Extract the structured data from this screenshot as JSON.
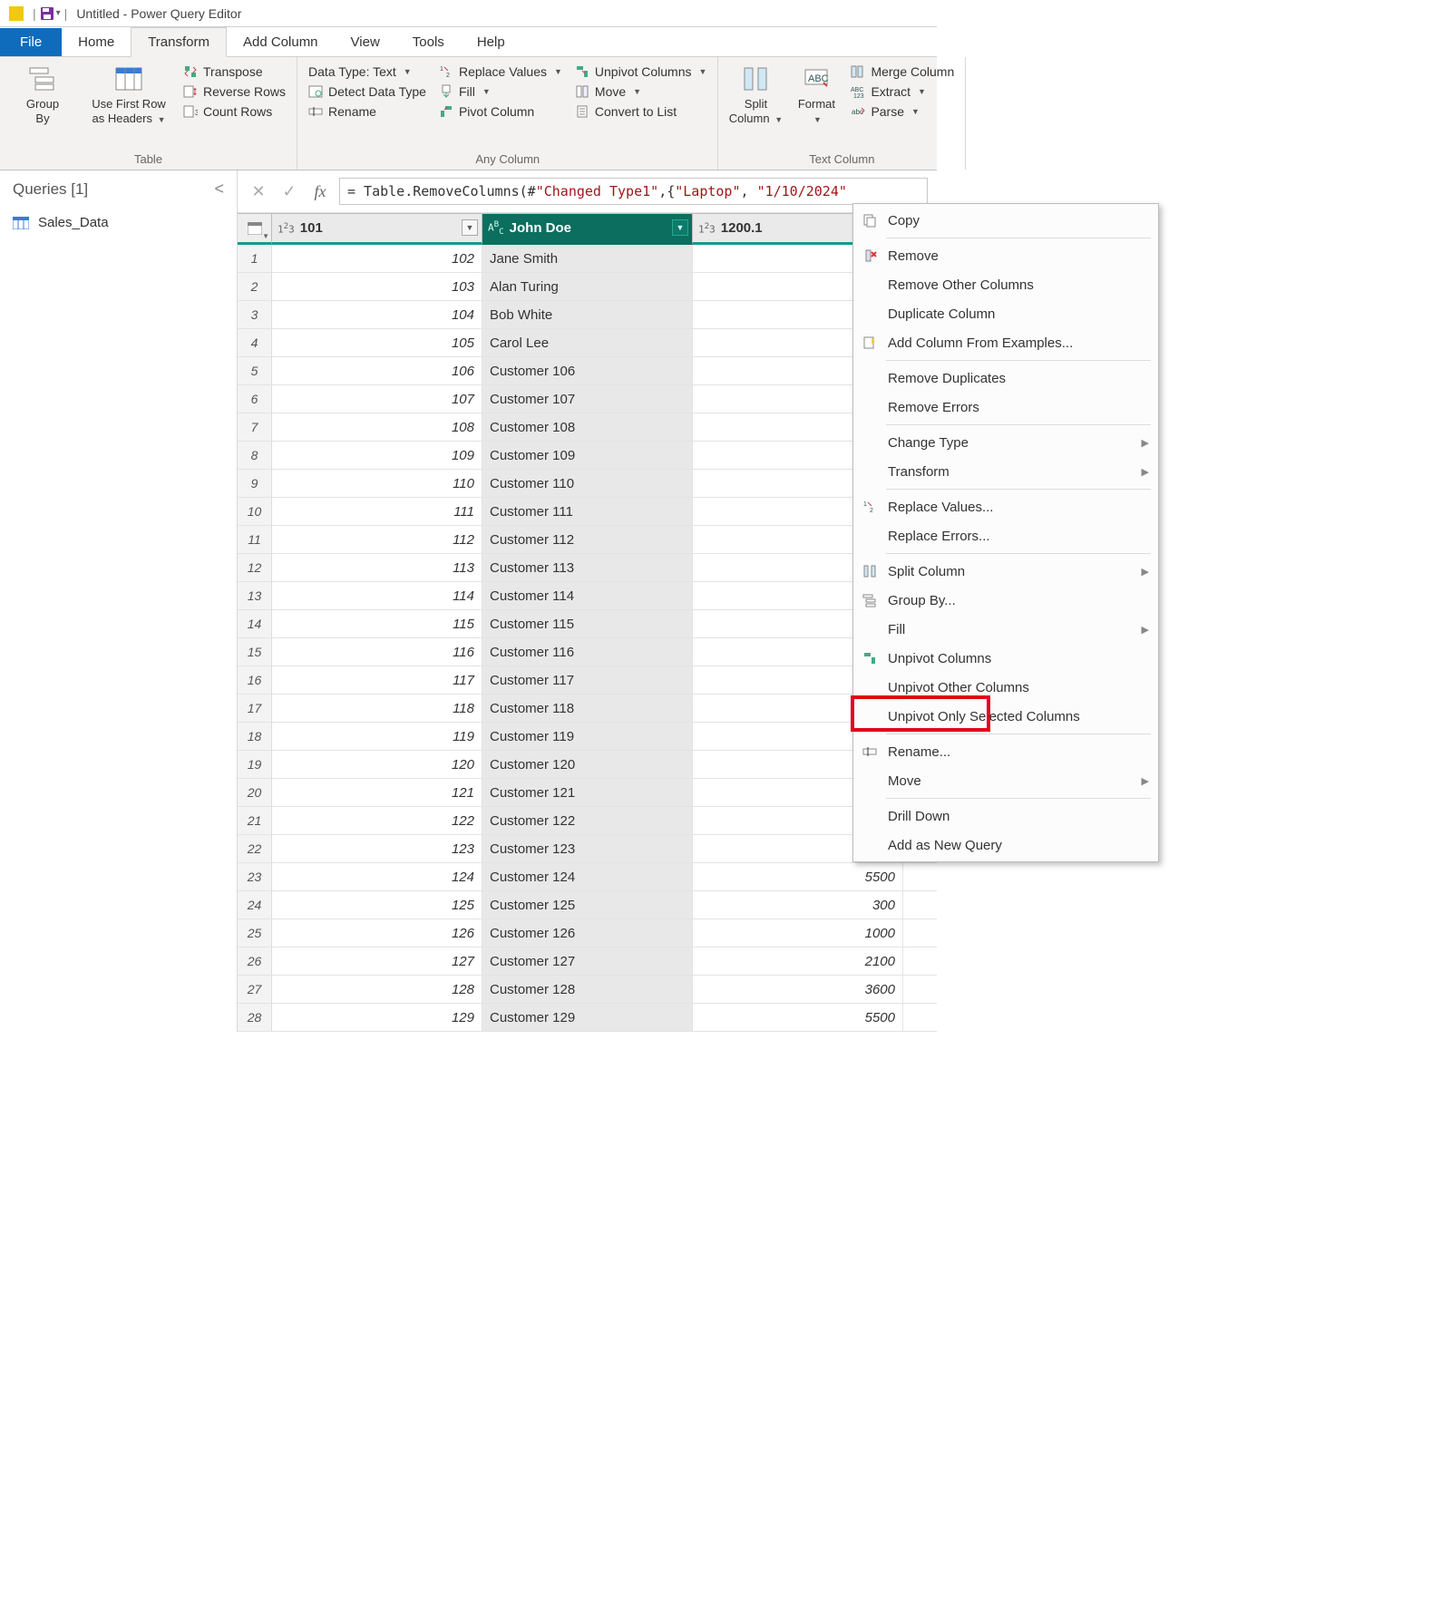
{
  "titlebar": {
    "title": "Untitled - Power Query Editor"
  },
  "tabs": {
    "file": "File",
    "home": "Home",
    "transform": "Transform",
    "addcol": "Add Column",
    "view": "View",
    "tools": "Tools",
    "help": "Help"
  },
  "ribbon": {
    "table": {
      "group_by": "Group\nBy",
      "use_first_row": "Use First Row\nas Headers",
      "transpose": "Transpose",
      "reverse_rows": "Reverse Rows",
      "count_rows": "Count Rows",
      "label": "Table"
    },
    "anycol": {
      "data_type": "Data Type: Text",
      "detect": "Detect Data Type",
      "rename": "Rename",
      "replace": "Replace Values",
      "fill": "Fill",
      "pivot": "Pivot Column",
      "unpivot": "Unpivot Columns",
      "move": "Move",
      "convert": "Convert to List",
      "label": "Any Column"
    },
    "textcol": {
      "split": "Split\nColumn",
      "format": "Format",
      "merge": "Merge Column",
      "extract": "Extract",
      "parse": "Parse",
      "label": "Text Column"
    }
  },
  "queries": {
    "header": "Queries [1]",
    "item": "Sales_Data"
  },
  "formula": {
    "prefix": "= Table.RemoveColumns(#",
    "q1": "\"Changed Type1\"",
    "mid": ",{",
    "q2": "\"Laptop\"",
    "mid2": ", ",
    "q3": "\"1/10/2024\""
  },
  "grid": {
    "headers": {
      "col1": "101",
      "col2": "John Doe",
      "col3": "1200.1",
      "type_num": "1²3",
      "type_txt": "AᴮC"
    },
    "rows": [
      {
        "n": "1",
        "c1": "102",
        "c2": "Jane Smith",
        "c3": ""
      },
      {
        "n": "2",
        "c1": "103",
        "c2": "Alan Turing",
        "c3": ""
      },
      {
        "n": "3",
        "c1": "104",
        "c2": "Bob White",
        "c3": ""
      },
      {
        "n": "4",
        "c1": "105",
        "c2": "Carol Lee",
        "c3": ""
      },
      {
        "n": "5",
        "c1": "106",
        "c2": "Customer 106",
        "c3": ""
      },
      {
        "n": "6",
        "c1": "107",
        "c2": "Customer 107",
        "c3": ""
      },
      {
        "n": "7",
        "c1": "108",
        "c2": "Customer 108",
        "c3": ""
      },
      {
        "n": "8",
        "c1": "109",
        "c2": "Customer 109",
        "c3": ""
      },
      {
        "n": "9",
        "c1": "110",
        "c2": "Customer 110",
        "c3": ""
      },
      {
        "n": "10",
        "c1": "111",
        "c2": "Customer 111",
        "c3": ""
      },
      {
        "n": "11",
        "c1": "112",
        "c2": "Customer 112",
        "c3": ""
      },
      {
        "n": "12",
        "c1": "113",
        "c2": "Customer 113",
        "c3": ""
      },
      {
        "n": "13",
        "c1": "114",
        "c2": "Customer 114",
        "c3": ""
      },
      {
        "n": "14",
        "c1": "115",
        "c2": "Customer 115",
        "c3": ""
      },
      {
        "n": "15",
        "c1": "116",
        "c2": "Customer 116",
        "c3": ""
      },
      {
        "n": "16",
        "c1": "117",
        "c2": "Customer 117",
        "c3": ""
      },
      {
        "n": "17",
        "c1": "118",
        "c2": "Customer 118",
        "c3": ""
      },
      {
        "n": "18",
        "c1": "119",
        "c2": "Customer 119",
        "c3": ""
      },
      {
        "n": "19",
        "c1": "120",
        "c2": "Customer 120",
        "c3": ""
      },
      {
        "n": "20",
        "c1": "121",
        "c2": "Customer 121",
        "c3": ""
      },
      {
        "n": "21",
        "c1": "122",
        "c2": "Customer 122",
        "c3": ""
      },
      {
        "n": "22",
        "c1": "123",
        "c2": "Customer 123",
        "c3": ""
      },
      {
        "n": "23",
        "c1": "124",
        "c2": "Customer 124",
        "c3": "5500"
      },
      {
        "n": "24",
        "c1": "125",
        "c2": "Customer 125",
        "c3": "300"
      },
      {
        "n": "25",
        "c1": "126",
        "c2": "Customer 126",
        "c3": "1000"
      },
      {
        "n": "26",
        "c1": "127",
        "c2": "Customer 127",
        "c3": "2100"
      },
      {
        "n": "27",
        "c1": "128",
        "c2": "Customer 128",
        "c3": "3600"
      },
      {
        "n": "28",
        "c1": "129",
        "c2": "Customer 129",
        "c3": "5500"
      }
    ]
  },
  "context": {
    "copy": "Copy",
    "remove": "Remove",
    "remove_other": "Remove Other Columns",
    "duplicate": "Duplicate Column",
    "add_from_examples": "Add Column From Examples...",
    "remove_dup": "Remove Duplicates",
    "remove_err": "Remove Errors",
    "change_type": "Change Type",
    "transform": "Transform",
    "replace_values": "Replace Values...",
    "replace_errors": "Replace Errors...",
    "split_column": "Split Column",
    "group_by": "Group By...",
    "fill": "Fill",
    "unpivot": "Unpivot Columns",
    "unpivot_other": "Unpivot Other Columns",
    "unpivot_selected": "Unpivot Only Selected Columns",
    "rename": "Rename...",
    "move": "Move",
    "drill": "Drill Down",
    "add_new_query": "Add as New Query"
  }
}
